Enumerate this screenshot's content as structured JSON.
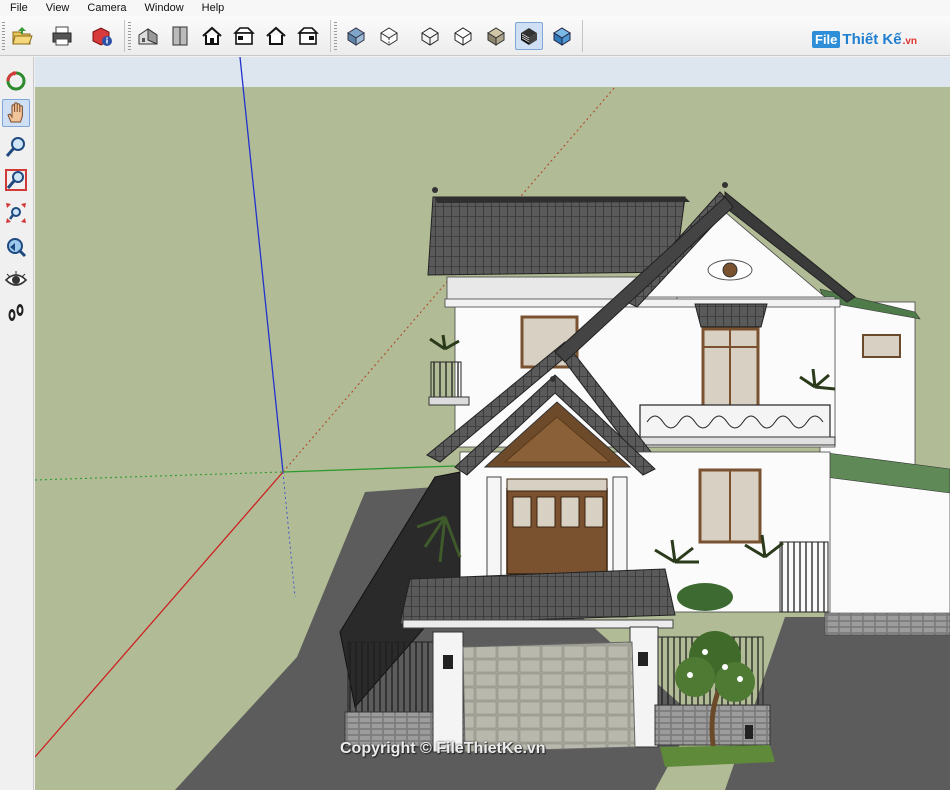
{
  "menu": {
    "items": [
      "File",
      "View",
      "Camera",
      "Window",
      "Help"
    ]
  },
  "brand": {
    "box": "File",
    "main": "Thiết Kế",
    "tld": ".vn"
  },
  "toolbar": {
    "groups": [
      [
        "open-folder-icon",
        "print-icon",
        "model-info-icon"
      ],
      [
        "iso-view-icon",
        "top-view-icon",
        "front-view-icon",
        "right-view-icon",
        "back-view-icon",
        "left-view-icon"
      ],
      [
        "xray-icon",
        "back-edges-icon",
        "wireframe-icon",
        "hidden-line-icon",
        "shaded-icon",
        "shaded-textures-icon",
        "monochrome-icon"
      ]
    ],
    "active": "shaded-textures-icon"
  },
  "sidebar": {
    "tools": [
      "orbit-icon",
      "pan-icon",
      "zoom-icon",
      "zoom-window-icon",
      "zoom-extents-icon",
      "previous-view-icon",
      "look-around-icon",
      "walk-icon"
    ],
    "active": "pan-icon"
  },
  "colors": {
    "ground": "#b1bc96",
    "sky": "#dde6ef",
    "road": "#5c5c5c",
    "axis_red": "#cc2222",
    "axis_green": "#2e9a2e",
    "axis_blue": "#2233cc",
    "roof": "#555555",
    "wall": "#fbfbfb",
    "wood": "#7a5230"
  },
  "watermark": "Copyright © FileThietKe.vn"
}
